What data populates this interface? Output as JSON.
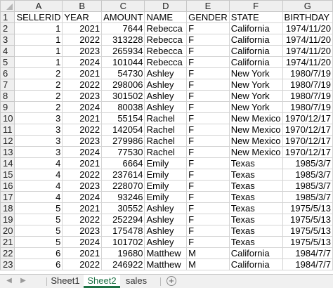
{
  "columns": [
    "A",
    "B",
    "C",
    "D",
    "E",
    "F",
    "G"
  ],
  "rows": [
    {
      "n": "1",
      "cells": [
        "SELLERID",
        "YEAR",
        "AMOUNT",
        "NAME",
        "GENDER",
        "STATE",
        "BIRTHDAY"
      ]
    },
    {
      "n": "2",
      "cells": [
        "1",
        "2021",
        "7644",
        "Rebecca",
        "F",
        "California",
        "1974/11/20"
      ]
    },
    {
      "n": "3",
      "cells": [
        "1",
        "2022",
        "313228",
        "Rebecca",
        "F",
        "California",
        "1974/11/20"
      ]
    },
    {
      "n": "4",
      "cells": [
        "1",
        "2023",
        "265934",
        "Rebecca",
        "F",
        "California",
        "1974/11/20"
      ]
    },
    {
      "n": "5",
      "cells": [
        "1",
        "2024",
        "101044",
        "Rebecca",
        "F",
        "California",
        "1974/11/20"
      ]
    },
    {
      "n": "6",
      "cells": [
        "2",
        "2021",
        "54730",
        "Ashley",
        "F",
        "New York",
        "1980/7/19"
      ]
    },
    {
      "n": "7",
      "cells": [
        "2",
        "2022",
        "298006",
        "Ashley",
        "F",
        "New York",
        "1980/7/19"
      ]
    },
    {
      "n": "8",
      "cells": [
        "2",
        "2023",
        "301502",
        "Ashley",
        "F",
        "New York",
        "1980/7/19"
      ]
    },
    {
      "n": "9",
      "cells": [
        "2",
        "2024",
        "80038",
        "Ashley",
        "F",
        "New York",
        "1980/7/19"
      ]
    },
    {
      "n": "10",
      "cells": [
        "3",
        "2021",
        "55154",
        "Rachel",
        "F",
        "New Mexico",
        "1970/12/17"
      ]
    },
    {
      "n": "11",
      "cells": [
        "3",
        "2022",
        "142054",
        "Rachel",
        "F",
        "New Mexico",
        "1970/12/17"
      ]
    },
    {
      "n": "12",
      "cells": [
        "3",
        "2023",
        "279986",
        "Rachel",
        "F",
        "New Mexico",
        "1970/12/17"
      ]
    },
    {
      "n": "13",
      "cells": [
        "3",
        "2024",
        "77530",
        "Rachel",
        "F",
        "New Mexico",
        "1970/12/17"
      ]
    },
    {
      "n": "14",
      "cells": [
        "4",
        "2021",
        "6664",
        "Emily",
        "F",
        "Texas",
        "1985/3/7"
      ]
    },
    {
      "n": "15",
      "cells": [
        "4",
        "2022",
        "237614",
        "Emily",
        "F",
        "Texas",
        "1985/3/7"
      ]
    },
    {
      "n": "16",
      "cells": [
        "4",
        "2023",
        "228070",
        "Emily",
        "F",
        "Texas",
        "1985/3/7"
      ]
    },
    {
      "n": "17",
      "cells": [
        "4",
        "2024",
        "93246",
        "Emily",
        "F",
        "Texas",
        "1985/3/7"
      ]
    },
    {
      "n": "18",
      "cells": [
        "5",
        "2021",
        "30552",
        "Ashley",
        "F",
        "Texas",
        "1975/5/13"
      ]
    },
    {
      "n": "19",
      "cells": [
        "5",
        "2022",
        "252294",
        "Ashley",
        "F",
        "Texas",
        "1975/5/13"
      ]
    },
    {
      "n": "20",
      "cells": [
        "5",
        "2023",
        "175478",
        "Ashley",
        "F",
        "Texas",
        "1975/5/13"
      ]
    },
    {
      "n": "21",
      "cells": [
        "5",
        "2024",
        "101702",
        "Ashley",
        "F",
        "Texas",
        "1975/5/13"
      ]
    },
    {
      "n": "22",
      "cells": [
        "6",
        "2021",
        "19680",
        "Matthew",
        "M",
        "California",
        "1984/7/7"
      ]
    },
    {
      "n": "23",
      "cells": [
        "6",
        "2022",
        "246922",
        "Matthew",
        "M",
        "California",
        "1984/7/7"
      ]
    }
  ],
  "tabs": {
    "dots": "...",
    "sheet1": "Sheet1",
    "sheet2": "Sheet2",
    "sales": "sales",
    "add": "+"
  }
}
